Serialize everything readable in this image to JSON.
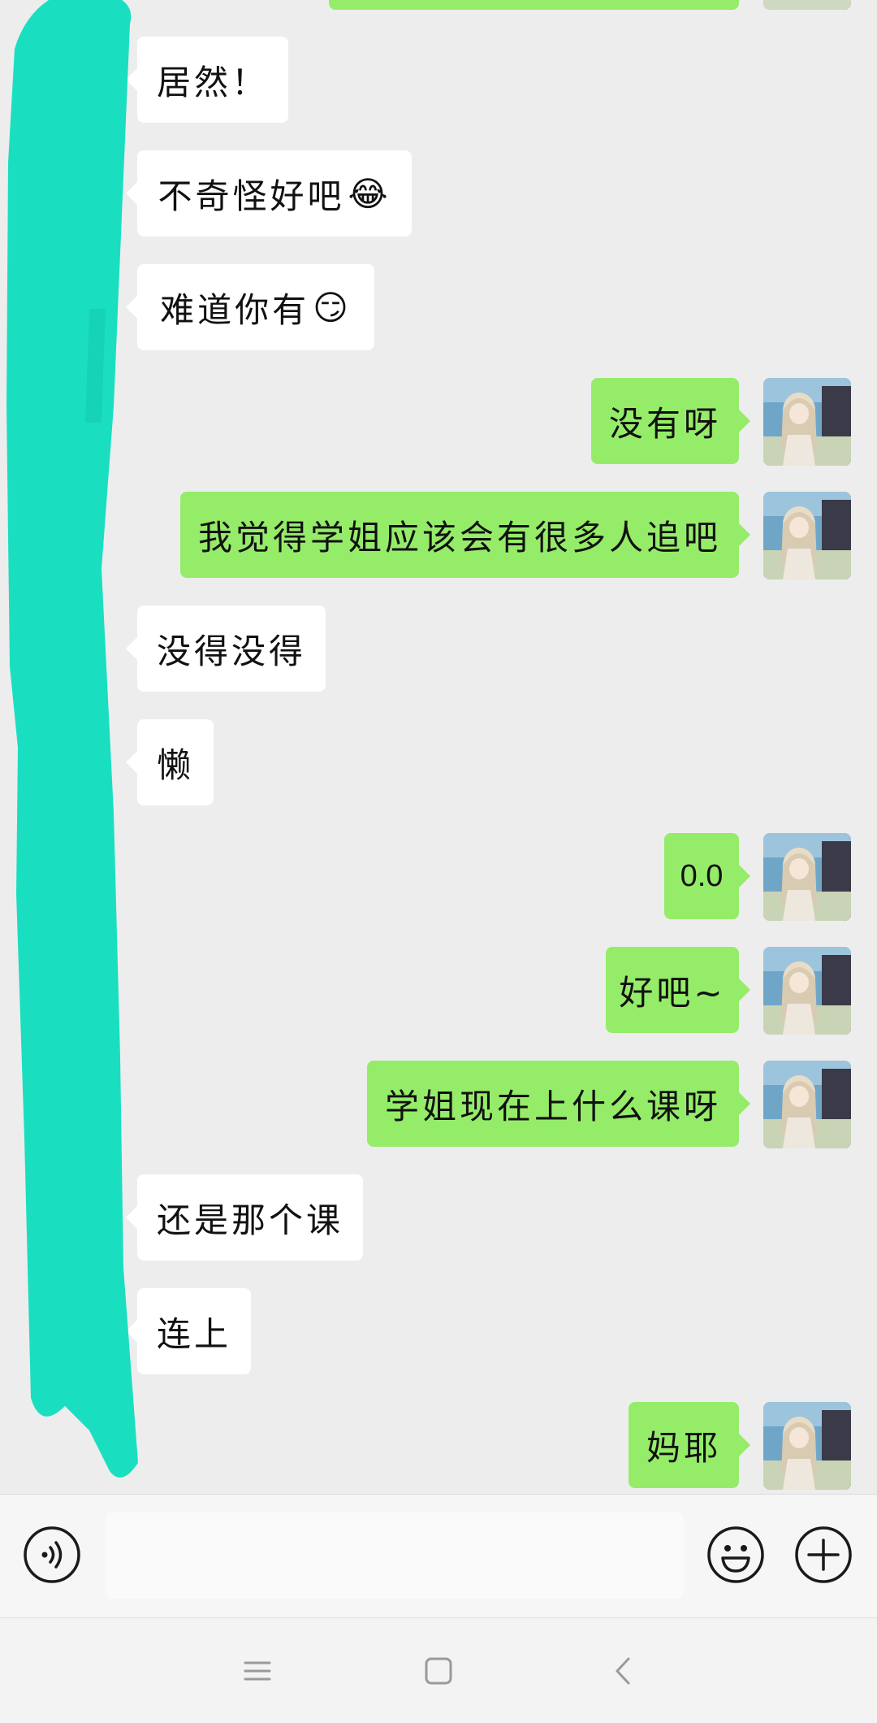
{
  "messages": [
    {
      "side": "in",
      "text": "居然！",
      "emoji": ""
    },
    {
      "side": "in",
      "text": "不奇怪好吧",
      "emoji": "😂"
    },
    {
      "side": "in",
      "text": "难道你有",
      "emoji": "😏"
    },
    {
      "side": "out",
      "text": "没有呀",
      "emoji": ""
    },
    {
      "side": "out",
      "text": "我觉得学姐应该会有很多人追吧",
      "emoji": ""
    },
    {
      "side": "in",
      "text": "没得没得",
      "emoji": ""
    },
    {
      "side": "in",
      "text": "懒",
      "emoji": ""
    },
    {
      "side": "out",
      "text": "0.0",
      "emoji": ""
    },
    {
      "side": "out",
      "text": "好吧~",
      "emoji": ""
    },
    {
      "side": "out",
      "text": "学姐现在上什么课呀",
      "emoji": ""
    },
    {
      "side": "in",
      "text": "还是那个课",
      "emoji": ""
    },
    {
      "side": "in",
      "text": "连上",
      "emoji": ""
    },
    {
      "side": "out",
      "text": "妈耶",
      "emoji": ""
    }
  ],
  "input": {
    "value": "",
    "placeholder": ""
  },
  "icons": {
    "voice": "voice-icon",
    "emoji": "emoji-icon",
    "more": "plus-icon",
    "nav_menu": "menu-icon",
    "nav_home": "home-icon",
    "nav_back": "back-icon"
  },
  "colors": {
    "background": "#ededed",
    "incoming_bubble": "#ffffff",
    "outgoing_bubble": "#95ec69",
    "redaction": "#19dfc0"
  }
}
